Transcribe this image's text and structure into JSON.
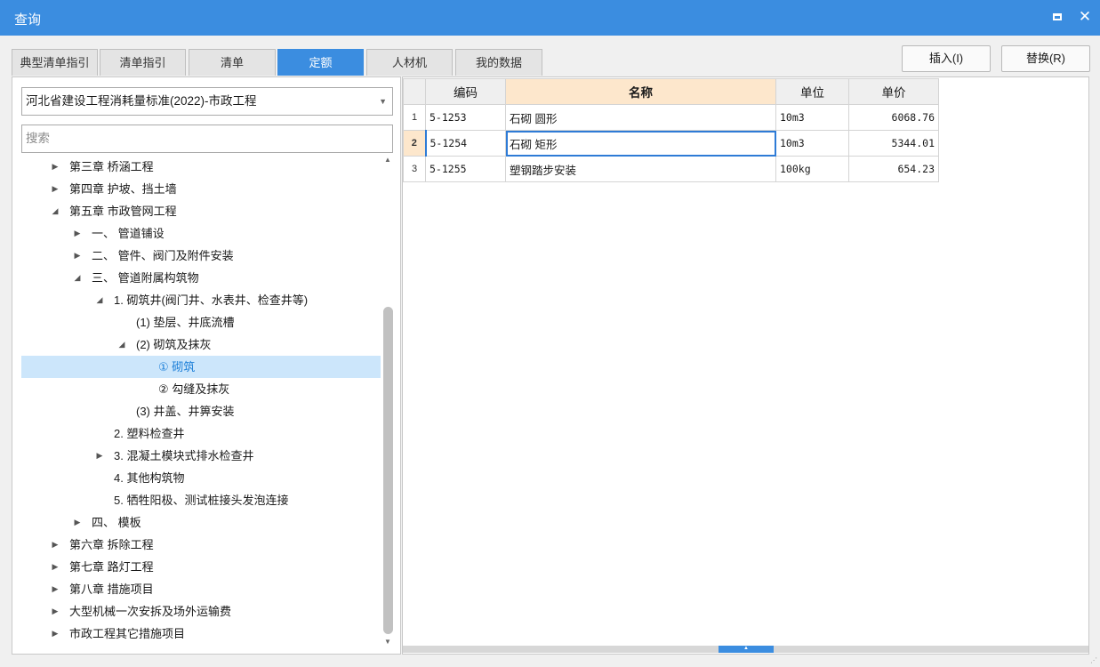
{
  "window": {
    "title": "查询"
  },
  "tabs": [
    {
      "label": "典型清单指引",
      "active": false
    },
    {
      "label": "清单指引",
      "active": false
    },
    {
      "label": "清单",
      "active": false
    },
    {
      "label": "定额",
      "active": true
    },
    {
      "label": "人材机",
      "active": false
    },
    {
      "label": "我的数据",
      "active": false
    }
  ],
  "buttons": {
    "insert": "插入(I)",
    "replace": "替换(R)"
  },
  "left": {
    "library_select": "河北省建设工程消耗量标准(2022)-市政工程",
    "search_placeholder": "搜索",
    "tree": [
      {
        "label": "第三章 桥涵工程",
        "toggle": "▶"
      },
      {
        "label": "第四章 护坡、挡土墙",
        "toggle": "▶"
      },
      {
        "label": "第五章 市政管网工程",
        "toggle": "◢"
      },
      {
        "label": "一、 管道铺设",
        "toggle": "▶"
      },
      {
        "label": "二、 管件、阀门及附件安装",
        "toggle": "▶"
      },
      {
        "label": "三、 管道附属构筑物",
        "toggle": "◢"
      },
      {
        "label": "1. 砌筑井(阀门井、水表井、检查井等)",
        "toggle": "◢"
      },
      {
        "label": "(1) 垫层、井底流槽",
        "toggle": ""
      },
      {
        "label": "(2) 砌筑及抹灰",
        "toggle": "◢"
      },
      {
        "label": "① 砌筑",
        "toggle": "",
        "selected": true
      },
      {
        "label": "② 勾缝及抹灰",
        "toggle": ""
      },
      {
        "label": "(3) 井盖、井箅安装",
        "toggle": ""
      },
      {
        "label": "2. 塑料检查井",
        "toggle": ""
      },
      {
        "label": "3. 混凝土模块式排水检查井",
        "toggle": "▶"
      },
      {
        "label": "4. 其他构筑物",
        "toggle": ""
      },
      {
        "label": "5. 牺牲阳极、测试桩接头发泡连接",
        "toggle": ""
      },
      {
        "label": "四、 模板",
        "toggle": "▶"
      },
      {
        "label": "第六章 拆除工程",
        "toggle": "▶"
      },
      {
        "label": "第七章 路灯工程",
        "toggle": "▶"
      },
      {
        "label": "第八章 措施项目",
        "toggle": "▶"
      },
      {
        "label": "大型机械一次安拆及场外运输费",
        "toggle": "▶"
      },
      {
        "label": "市政工程其它措施项目",
        "toggle": "▶"
      }
    ]
  },
  "grid": {
    "headers": [
      "编码",
      "名称",
      "单位",
      "单价"
    ],
    "rows": [
      {
        "no": "1",
        "code": "5-1253",
        "name": "石砌 圆形",
        "unit": "10m3",
        "price": "6068.76"
      },
      {
        "no": "2",
        "code": "5-1254",
        "name": "石砌 矩形",
        "unit": "10m3",
        "price": "5344.01"
      },
      {
        "no": "3",
        "code": "5-1255",
        "name": "塑钢踏步安装",
        "unit": "100kg",
        "price": "654.23"
      }
    ]
  }
}
